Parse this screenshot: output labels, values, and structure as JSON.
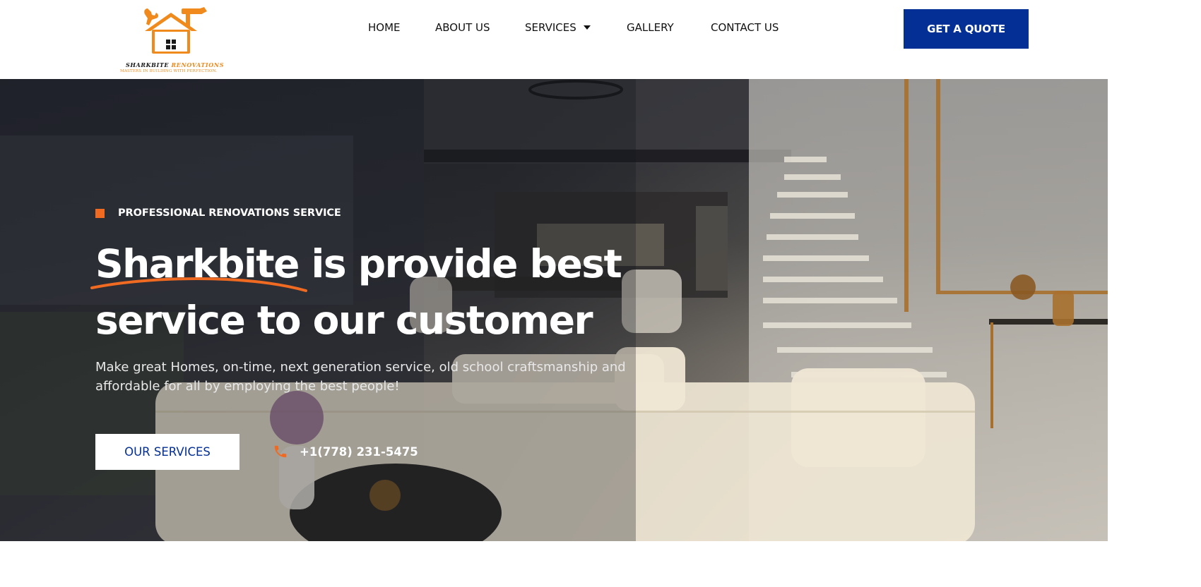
{
  "logo": {
    "brand_part1": "SHARKBITE",
    "brand_part2": "RENOVATIONS",
    "tagline": "MASTERS IN BUILDING WITH PERFECTION."
  },
  "nav": {
    "items": [
      {
        "label": "HOME"
      },
      {
        "label": "ABOUT US"
      },
      {
        "label": "SERVICES"
      },
      {
        "label": "GALLERY"
      },
      {
        "label": "CONTACT US"
      }
    ]
  },
  "header": {
    "cta_label": "GET A QUOTE"
  },
  "hero": {
    "eyebrow": "PROFESSIONAL RENOVATIONS SERVICE",
    "headline_highlight": "Sharkbite",
    "headline_rest1": " is provide best",
    "headline_line2": "service to our customer",
    "subtext": "Make great Homes, on-time, next generation service, old school craftsmanship and affordable for all by employing the best people!",
    "services_button": "OUR SERVICES",
    "phone": "+1(778) 231-5475"
  },
  "colors": {
    "brand_blue": "#042f94",
    "accent_orange": "#f06a22",
    "logo_orange": "#f08a1c"
  }
}
